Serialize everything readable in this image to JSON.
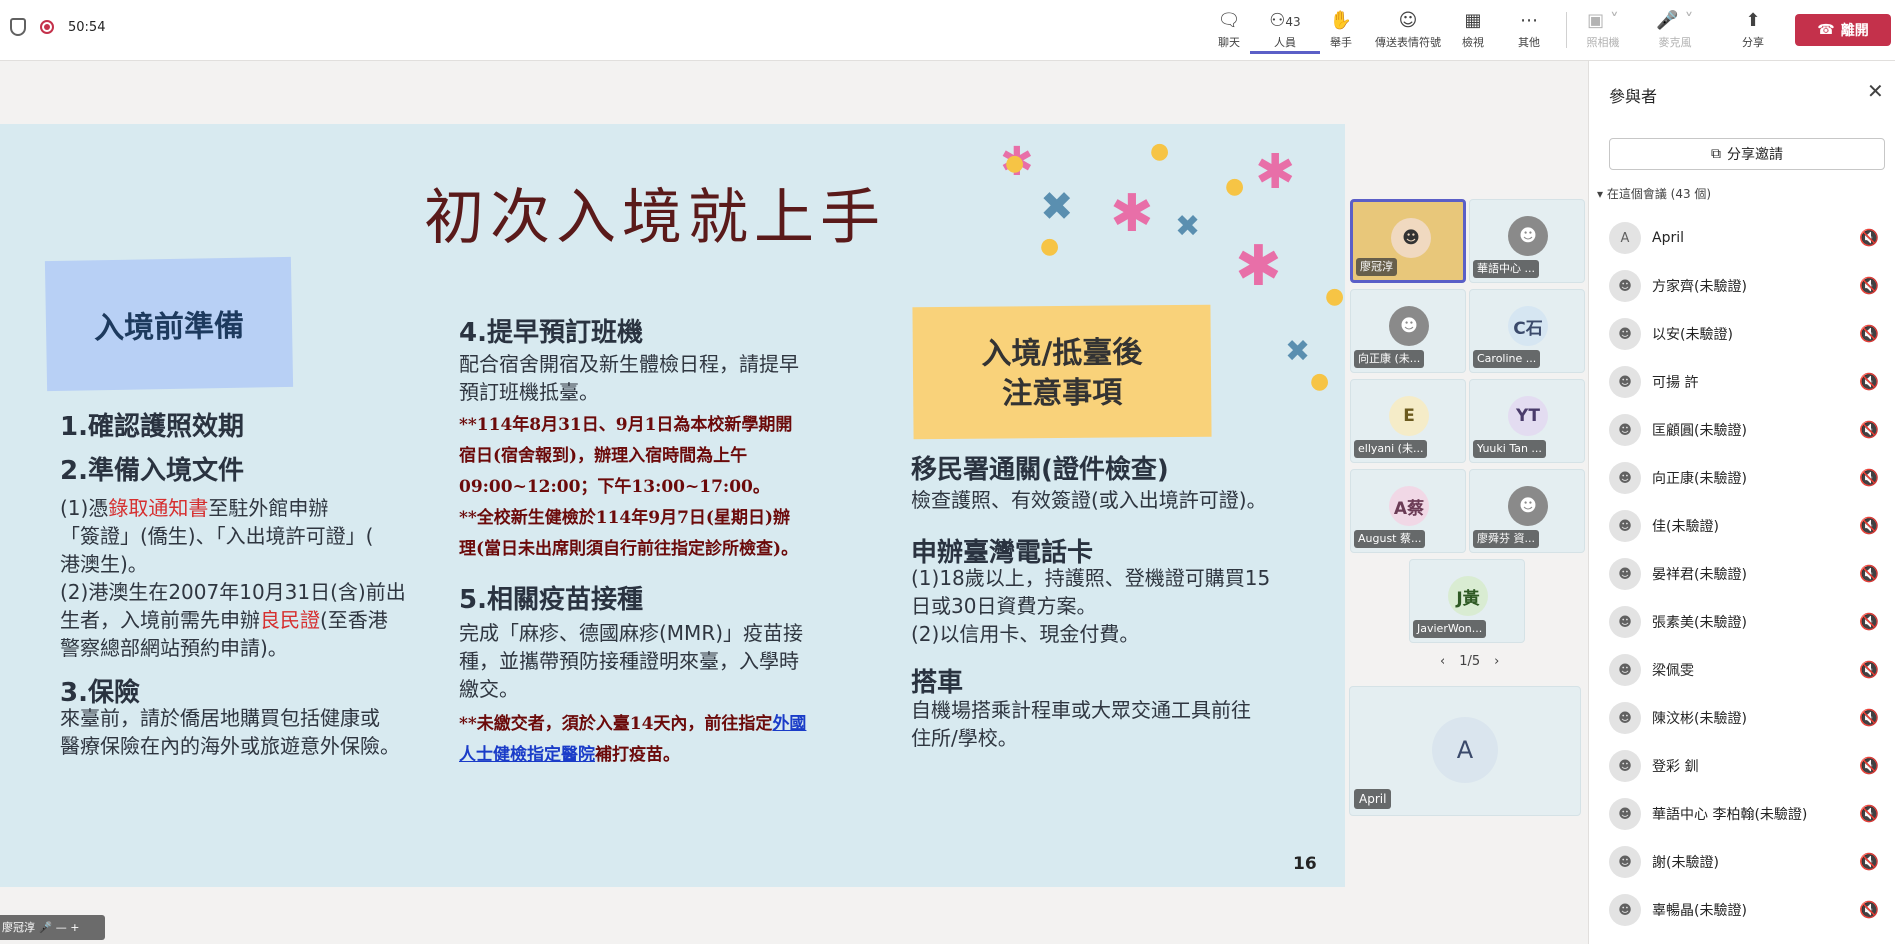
{
  "topbar": {
    "timer": "50:54",
    "buttons": [
      {
        "label": "聊天",
        "icon": "chat-icon"
      },
      {
        "label": "人員",
        "icon": "people-icon",
        "count": "43"
      },
      {
        "label": "舉手",
        "icon": "raise-hand-icon"
      },
      {
        "label": "傳送表情符號",
        "icon": "emoji-icon"
      },
      {
        "label": "檢視",
        "icon": "view-icon"
      },
      {
        "label": "其他",
        "icon": "more-icon"
      },
      {
        "label": "照相機",
        "icon": "camera-off-icon"
      },
      {
        "label": "麥克風",
        "icon": "mic-off-icon"
      },
      {
        "label": "分享",
        "icon": "share-icon"
      }
    ],
    "leave_label": "離開"
  },
  "slide": {
    "title": "初次入境就上手",
    "box_before": "入境前準備",
    "box_after_line1": "入境/抵臺後",
    "box_after_line2": "注意事項",
    "s1": "1.確認護照效期",
    "s2": "2.準備入境文件",
    "s2_p1a": "(1)憑",
    "s2_p1_red": "錄取通知書",
    "s2_p1b": "至駐外館申辦",
    "s2_p1c": "「簽證」(僑生)、「入出境許可證」(",
    "s2_p1d": "港澳生)。",
    "s2_p2a": "(2)港澳生在2007年10月31日(含)前出",
    "s2_p2b": "生者，入境前需先申辦",
    "s2_p2_red": "良民證",
    "s2_p2c": "(至香港",
    "s2_p2d": "警察總部網站預約申請)。",
    "s3": "3.保險",
    "s3_p1": "來臺前，請於僑居地購買包括健康或",
    "s3_p2": "醫療保險在內的海外或旅遊意外保險。",
    "s4": "4.提早預訂班機",
    "s4_p1": "配合宿舍開宿及新生體檢日程，請提早",
    "s4_p2": "預訂班機抵臺。",
    "s4_n1": "**114年8月31日、9月1日為本校新學期開",
    "s4_n2": "宿日(宿舍報到)，辦理入宿時間為上午",
    "s4_n3": "09:00~12:00；下午13:00~17:00。",
    "s4_n4": "**全校新生健檢於114年9月7日(星期日)辦",
    "s4_n5": "理(當日未出席則須自行前往指定診所檢查)。",
    "s5": "5.相關疫苗接種",
    "s5_p1": "完成「麻疹、德國麻疹(MMR)」疫苗接",
    "s5_p2": "種，並攜帶預防接種證明來臺，入學時",
    "s5_p3": "繳交。",
    "s5_n1a": "**未繳交者，須於入臺14天內，前往指定",
    "s5_n1_link": "外國",
    "s5_n2_link": "人士健檢指定醫院",
    "s5_n2b": "補打疫苗。",
    "r1": "移民署通關(證件檢查)",
    "r1_p": "檢查護照、有效簽證(或入出境許可證)。",
    "r2": "申辦臺灣電話卡",
    "r2_p1": "(1)18歲以上，持護照、登機證可購買15",
    "r2_p2": "日或30日資費方案。",
    "r2_p3": "(2)以信用卡、現金付費。",
    "r3": "搭車",
    "r3_p1": "自機場搭乘計程車或大眾交通工具前往",
    "r3_p2": "住所/學校。",
    "page": "16"
  },
  "gallery": {
    "tiles": [
      {
        "name": "廖冠淳",
        "initials": "",
        "bg": "#e8c77a"
      },
      {
        "name": "華語中心 ...",
        "initials": "",
        "bg": "#8a8a8a"
      },
      {
        "name": "向正康 (未...",
        "initials": "",
        "bg": "#8a8a8a"
      },
      {
        "name": "Caroline ...",
        "initials": "C石",
        "bg": "#d6e6f2"
      },
      {
        "name": "ellyani (未...",
        "initials": "E",
        "bg": "#f5ecc8"
      },
      {
        "name": "Yuuki Tan ...",
        "initials": "YT",
        "bg": "#e3dcf1"
      },
      {
        "name": "August 蔡...",
        "initials": "A蔡",
        "bg": "#f1d8e6"
      },
      {
        "name": "廖舜芬 資...",
        "initials": "",
        "bg": "#8a8a8a"
      },
      {
        "name": "JavierWon...",
        "initials": "J黃",
        "bg": "#d9ecd2"
      }
    ],
    "pager": "1/5",
    "featured_name": "April",
    "featured_initial": "A"
  },
  "presenter_tag": "廖冠淳",
  "panel": {
    "title": "參與者",
    "share_invite": "分享邀請",
    "section": "在這個會議 (43 個)",
    "participants": [
      {
        "name": "April",
        "initial": "A"
      },
      {
        "name": "方家齊(未驗證)",
        "initial": ""
      },
      {
        "name": "以安(未驗證)",
        "initial": ""
      },
      {
        "name": "可揚 許",
        "initial": ""
      },
      {
        "name": "匡顧圓(未驗證)",
        "initial": ""
      },
      {
        "name": "向正康(未驗證)",
        "initial": ""
      },
      {
        "name": "佳(未驗證)",
        "initial": ""
      },
      {
        "name": "晏祥君(未驗證)",
        "initial": ""
      },
      {
        "name": "張素美(未驗證)",
        "initial": ""
      },
      {
        "name": "梁佩雯",
        "initial": ""
      },
      {
        "name": "陳汶彬(未驗證)",
        "initial": ""
      },
      {
        "name": "登彩 釧",
        "initial": ""
      },
      {
        "name": "華語中心 李柏翰(未驗證)",
        "initial": ""
      },
      {
        "name": "謝(未驗證)",
        "initial": ""
      },
      {
        "name": "辜暢晶(未驗證)",
        "initial": ""
      }
    ]
  }
}
